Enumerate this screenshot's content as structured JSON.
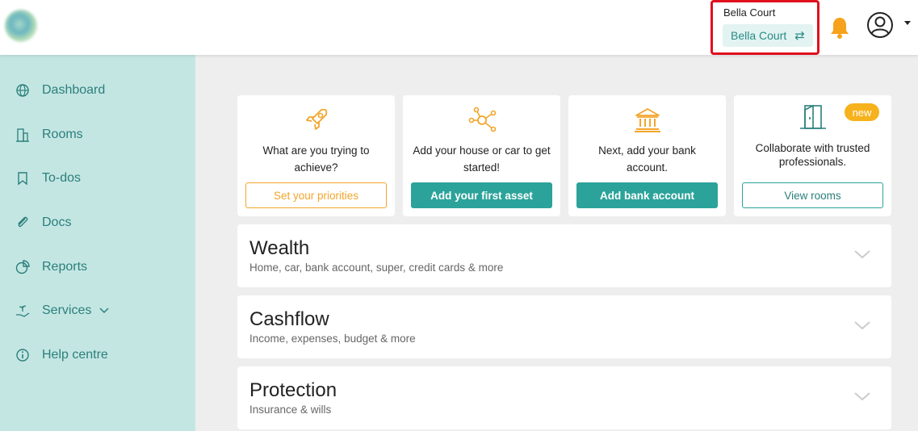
{
  "header": {
    "account_title": "Bella Court",
    "account_selected": "Bella Court",
    "swap_glyph": "⇄",
    "icons": [
      "logo",
      "bell-icon",
      "user-avatar-icon",
      "caret-down-icon"
    ]
  },
  "sidebar": {
    "items": [
      {
        "label": "Dashboard",
        "icon": "globe-icon"
      },
      {
        "label": "Rooms",
        "icon": "building-icon"
      },
      {
        "label": "To-dos",
        "icon": "bookmark-icon"
      },
      {
        "label": "Docs",
        "icon": "paperclip-icon"
      },
      {
        "label": "Reports",
        "icon": "pie-chart-icon"
      },
      {
        "label": "Services",
        "icon": "hand-plant-icon"
      },
      {
        "label": "Help centre",
        "icon": "info-icon"
      }
    ]
  },
  "cards": [
    {
      "text": "What are you trying to achieve?",
      "button": "Set your priorities",
      "icon": "rocket-icon"
    },
    {
      "text": "Add your house or car to get started!",
      "button": "Add your first asset",
      "icon": "network-icon"
    },
    {
      "text": "Next, add your bank account.",
      "button": "Add bank account",
      "icon": "bank-icon"
    },
    {
      "text": "Collaborate with trusted professionals.",
      "button": "View rooms",
      "icon": "door-icon",
      "badge": "new"
    }
  ],
  "sections": [
    {
      "title": "Wealth",
      "subtitle": "Home, car, bank account, super, credit cards & more"
    },
    {
      "title": "Cashflow",
      "subtitle": "Income, expenses, budget & more"
    },
    {
      "title": "Protection",
      "subtitle": "Insurance & wills"
    }
  ],
  "colors": {
    "accent_teal": "#2ba39a",
    "sidebar_bg": "#c4e6e3",
    "accent_orange": "#f2a52b",
    "highlight_red": "#e0101e"
  }
}
